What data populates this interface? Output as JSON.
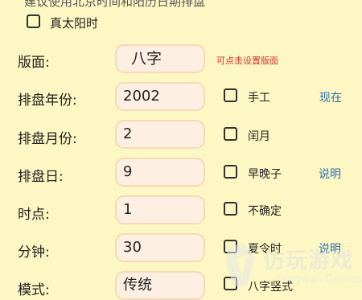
{
  "top_note": "建议使用北京时间和阳历日期排盘",
  "true_solar": {
    "label": "真太阳时",
    "checked": false
  },
  "layout": {
    "label": "版面:",
    "value": "八字",
    "hint": "可点击设置版面"
  },
  "year": {
    "label": "排盘年份:",
    "value": "2002",
    "manual_label": "手工",
    "now_link": "现在"
  },
  "month": {
    "label": "排盘月份:",
    "value": "2",
    "leap_label": "闰月"
  },
  "day": {
    "label": "排盘日:",
    "value": "9",
    "zi_label": "早晚子",
    "help_link": "说明"
  },
  "hour": {
    "label": "时点:",
    "value": "1",
    "uncertain_label": "不确定"
  },
  "minute": {
    "label": "分钟:",
    "value": "30",
    "dst_label": "夏令时",
    "help_link": "说明"
  },
  "mode": {
    "label": "模式:",
    "value": "传统",
    "vertical_label": "八字竖式"
  },
  "watermark": {
    "text": "仿玩游戏",
    "sub": "Fangwan Games"
  }
}
